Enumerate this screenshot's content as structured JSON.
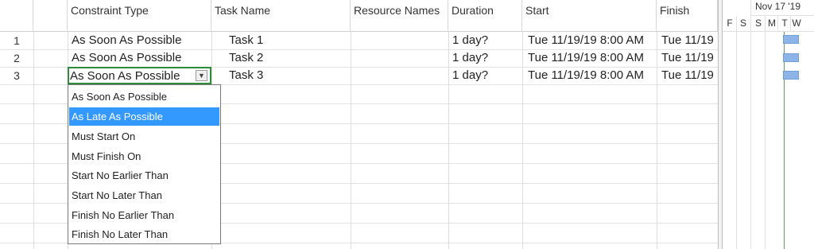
{
  "columns": {
    "info_icon": "info-icon",
    "constraint_type": "Constraint Type",
    "task_name": "Task Name",
    "resource_names": "Resource Names",
    "duration": "Duration",
    "start": "Start",
    "finish": "Finish"
  },
  "rows": [
    {
      "id": "1",
      "constraint": "As Soon As Possible",
      "task": "Task 1",
      "resource": "",
      "duration": "1 day?",
      "start": "Tue 11/19/19 8:00 AM",
      "finish": "Tue 11/19"
    },
    {
      "id": "2",
      "constraint": "As Soon As Possible",
      "task": "Task 2",
      "resource": "",
      "duration": "1 day?",
      "start": "Tue 11/19/19 8:00 AM",
      "finish": "Tue 11/19"
    },
    {
      "id": "3",
      "constraint": "As Soon As Possible",
      "task": "Task 3",
      "resource": "",
      "duration": "1 day?",
      "start": "Tue 11/19/19 8:00 AM",
      "finish": "Tue 11/19"
    }
  ],
  "dropdown": {
    "selected": "As Late As Possible",
    "options": [
      "As Soon As Possible",
      "As Late As Possible",
      "Must Start On",
      "Must Finish On",
      "Start No Earlier Than",
      "Start No Later Than",
      "Finish No Earlier Than",
      "Finish No Later Than"
    ]
  },
  "timeline": {
    "week": "Nov 17 '19",
    "days": [
      "F",
      "S",
      "S",
      "M",
      "T",
      "W"
    ]
  },
  "colors": {
    "selection": "#3399ff",
    "gantt_bar": "#8cb4e6",
    "active_cell_border": "#2e8b3a",
    "info_icon": "#1f4fb5"
  }
}
